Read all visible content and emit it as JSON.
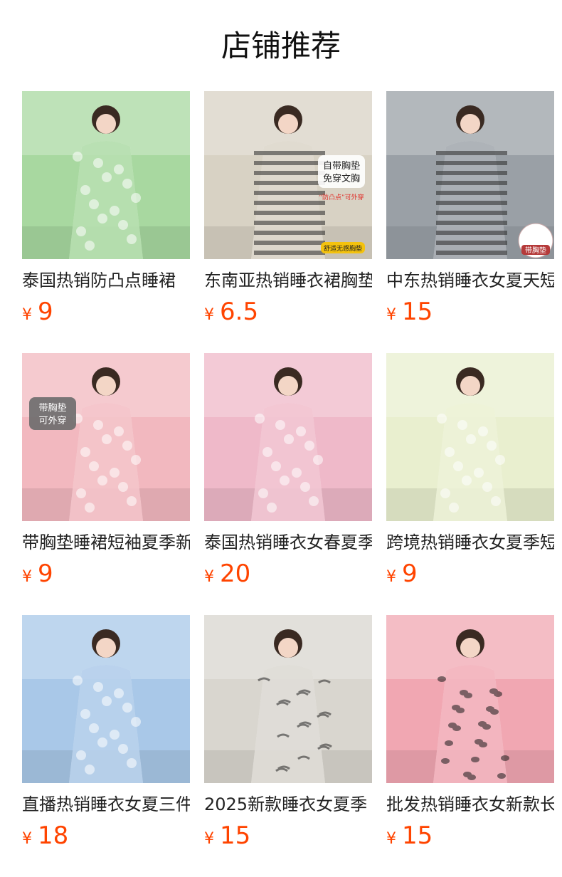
{
  "header": {
    "title": "店铺推荐"
  },
  "products": [
    {
      "name": "泰国热销防凸点睡裙",
      "currency": "¥",
      "price": "9",
      "thumb_icon": "floral-dress-photo",
      "thumb_color": "#a8d8a0"
    },
    {
      "name": "东南亚热销睡衣裙胸垫",
      "currency": "¥",
      "price": "6.5",
      "thumb_icon": "striped-dress-photo",
      "thumb_color": "#d8d2c4",
      "badge_lines": [
        "自带胸垫",
        "免穿文胸"
      ],
      "badge_note": "“防凸点”可外穿",
      "badge_foot": "舒适无感胸垫"
    },
    {
      "name": "中东热销睡衣女夏天短袖",
      "currency": "¥",
      "price": "15",
      "thumb_icon": "striped-tee-photo",
      "thumb_color": "#9aa0a6",
      "corner_tag": "带胸垫"
    },
    {
      "name": "带胸垫睡裙短袖夏季新款",
      "currency": "¥",
      "price": "9",
      "thumb_icon": "pink-dress-photo",
      "thumb_color": "#f2b8bf",
      "badge_lines": [
        "带胸垫",
        "可外穿"
      ]
    },
    {
      "name": "泰国热销睡衣女春夏季",
      "currency": "¥",
      "price": "20",
      "thumb_icon": "cartoon-print-photo",
      "thumb_color": "#efb9c9"
    },
    {
      "name": "跨境热销睡衣女夏季短袖",
      "currency": "¥",
      "price": "9",
      "thumb_icon": "bear-print-photo",
      "thumb_color": "#e9efcf"
    },
    {
      "name": "直播热销睡衣女夏三件套",
      "currency": "¥",
      "price": "18",
      "thumb_icon": "blue-pajama-photo",
      "thumb_color": "#a9c8e8"
    },
    {
      "name": "2025新款睡衣女夏季",
      "currency": "¥",
      "price": "15",
      "thumb_icon": "ink-print-pajama-photo",
      "thumb_color": "#d9d6cf"
    },
    {
      "name": "批发热销睡衣女新款长袖",
      "currency": "¥",
      "price": "15",
      "thumb_icon": "leopard-pajama-photo",
      "thumb_color": "#f1a7b2"
    }
  ]
}
